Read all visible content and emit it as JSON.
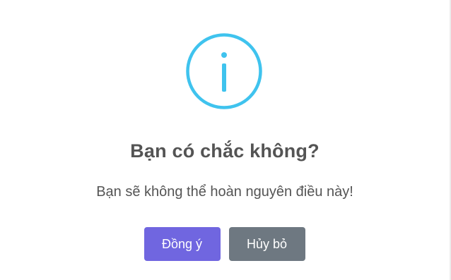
{
  "dialog": {
    "icon": "info-icon",
    "icon_color": "#3fc3ee",
    "title": "Bạn có chắc không?",
    "message": "Bạn sẽ không thể hoàn nguyên điều này!",
    "confirm_label": "Đồng ý",
    "cancel_label": "Hủy bỏ",
    "confirm_color": "#7066e0",
    "cancel_color": "#6e7881"
  }
}
